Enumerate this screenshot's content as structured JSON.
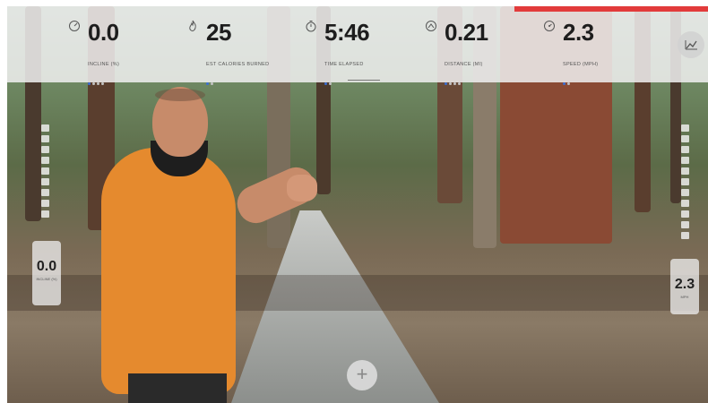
{
  "metrics": [
    {
      "id": "incline",
      "value": "0.0",
      "label": "INCLINE (%)",
      "icon": "incline-gauge-icon",
      "dots_on": 1,
      "dots_total": 4
    },
    {
      "id": "calories",
      "value": "25",
      "label": "EST CALORIES BURNED",
      "icon": "flame-icon",
      "dots_on": 1,
      "dots_total": 2
    },
    {
      "id": "time",
      "value": "5:46",
      "label": "TIME ELAPSED",
      "icon": "stopwatch-icon",
      "dots_on": 1,
      "dots_total": 2
    },
    {
      "id": "distance",
      "value": "0.21",
      "label": "DISTANCE (MI)",
      "icon": "route-icon",
      "dots_on": 1,
      "dots_total": 4
    },
    {
      "id": "speed",
      "value": "2.3",
      "label": "SPEED (MPH)",
      "icon": "speedometer-icon",
      "dots_on": 1,
      "dots_total": 2
    }
  ],
  "left_gauge": {
    "value": "0.0",
    "label": "INCLINE (%)"
  },
  "right_gauge": {
    "value": "2.3",
    "label": "MPH"
  },
  "controls": {
    "add_label": "+",
    "chart_icon": "chart-icon"
  },
  "colors": {
    "accent_red": "#e23b3b",
    "dot_active": "#3b6fd4",
    "shirt": "#e58a2e"
  }
}
